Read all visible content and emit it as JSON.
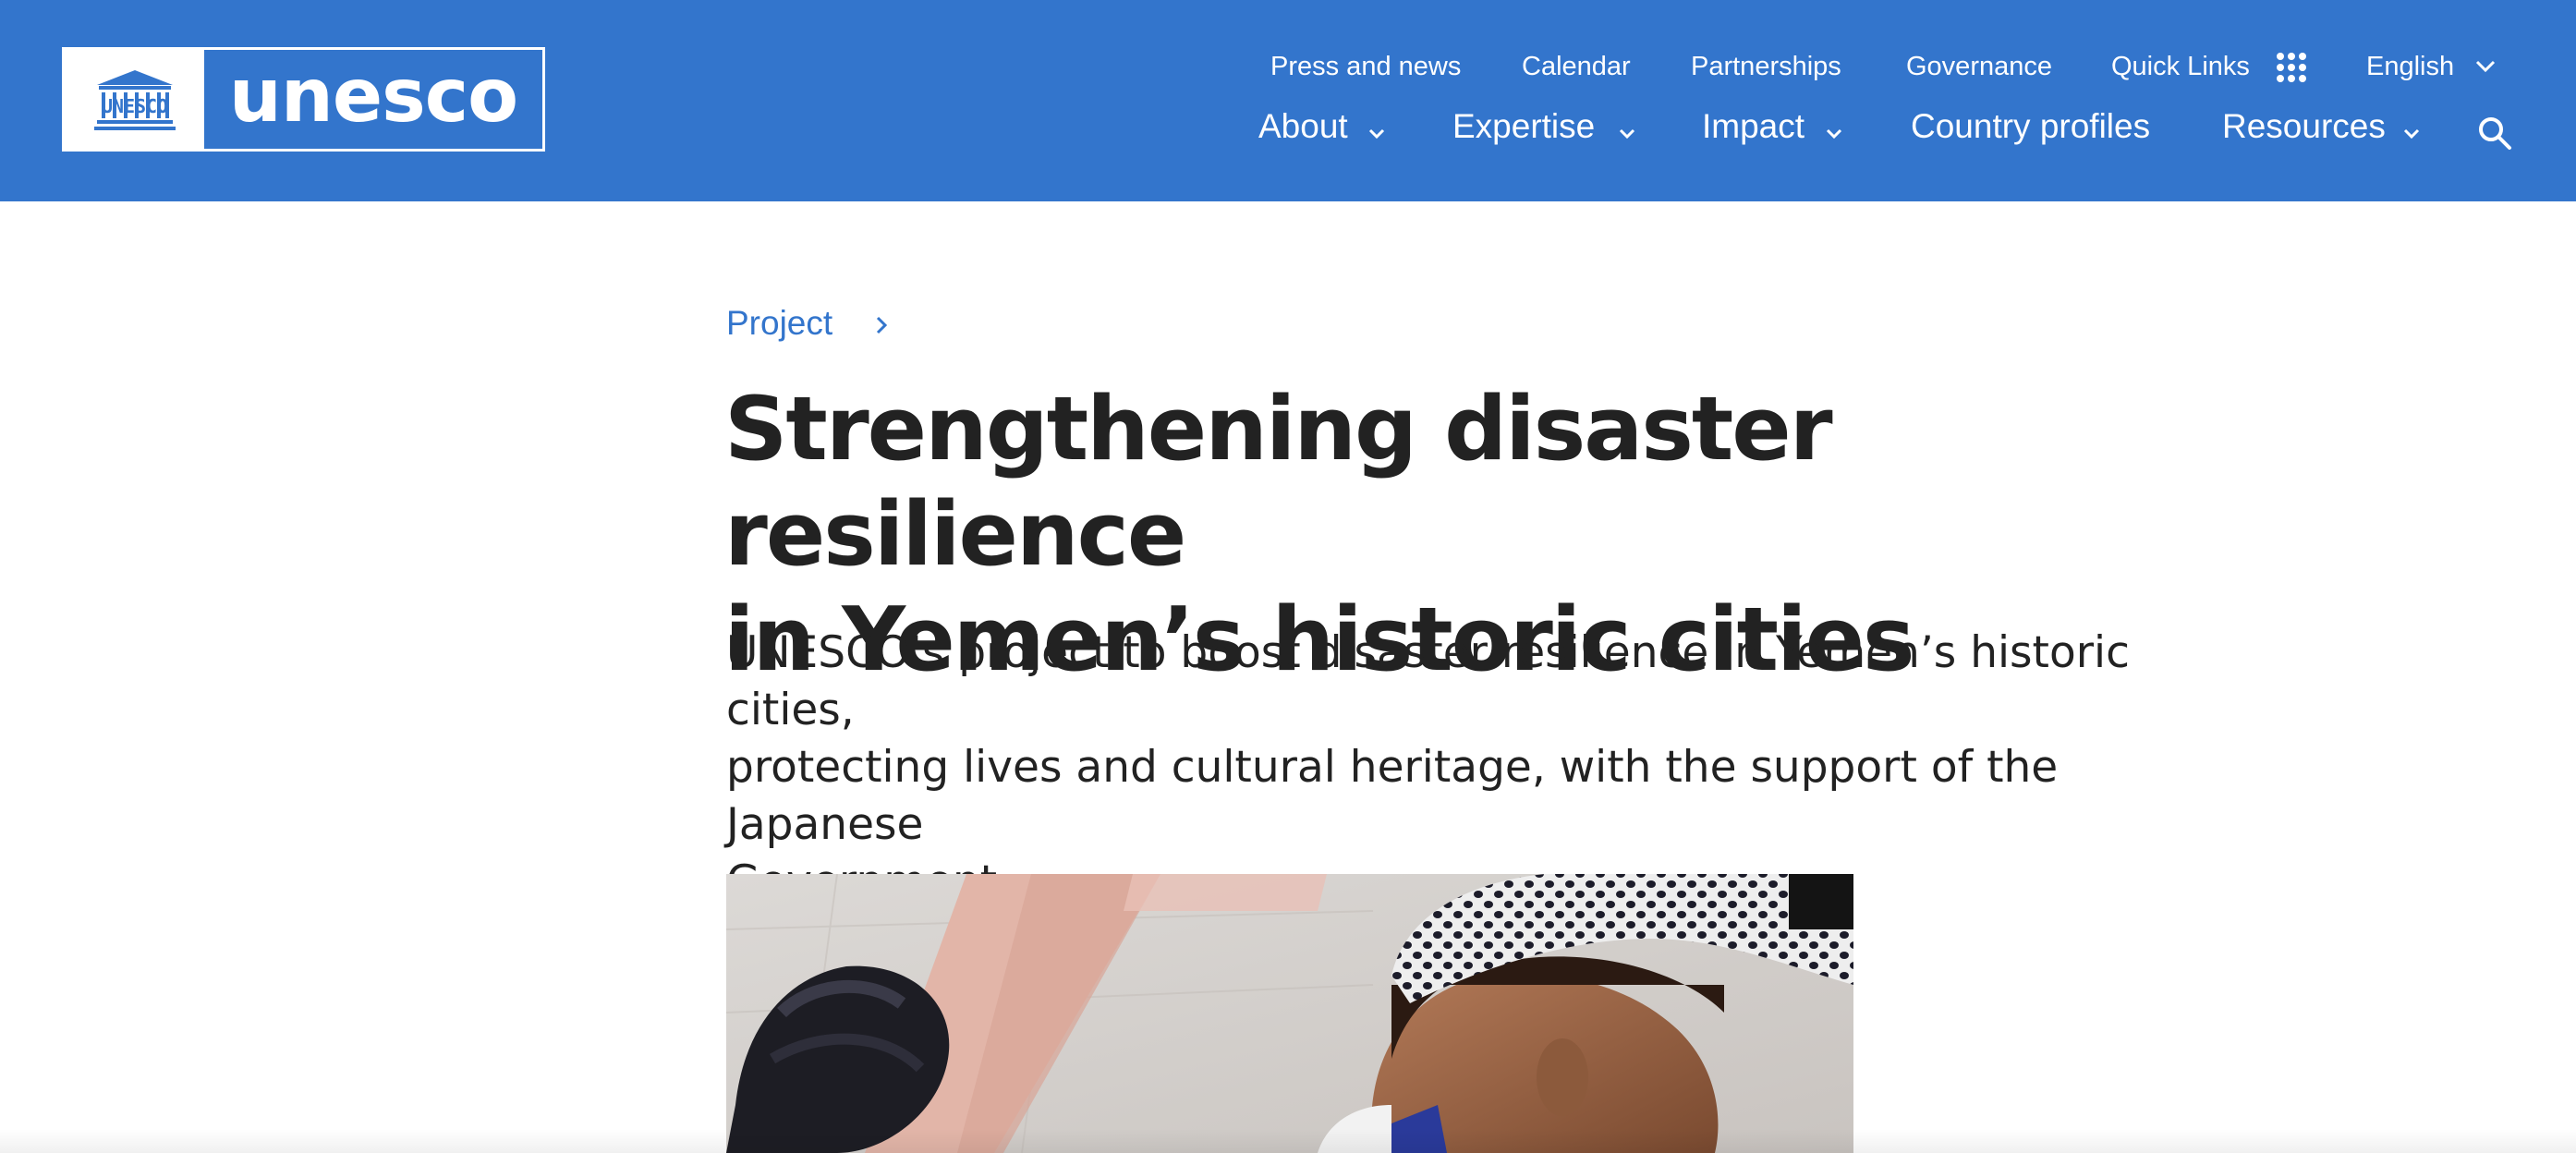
{
  "brand": {
    "logo_word": "unesco",
    "logo_emblem_text": "UNESCO",
    "header_color": "#3375cc",
    "link_color": "#3375cc"
  },
  "top_nav": {
    "items": [
      "Press and news",
      "Calendar",
      "Partnerships",
      "Governance"
    ],
    "quick_links": "Quick Links",
    "language": "English"
  },
  "main_nav": {
    "items": [
      "About",
      "Expertise",
      "Impact",
      "Country profiles",
      "Resources"
    ],
    "search_icon": "search-icon"
  },
  "article": {
    "breadcrumb": "Project",
    "title_line1": "Strengthening disaster resilience",
    "title_line2": "in Yemen’s historic cities",
    "lede_line1": "UNESCO's project to boost disaster resilience in Yemen’s historic cities,",
    "lede_line2": "protecting lives and cultural heritage, with the support of the Japanese",
    "lede_line3": "Government."
  }
}
